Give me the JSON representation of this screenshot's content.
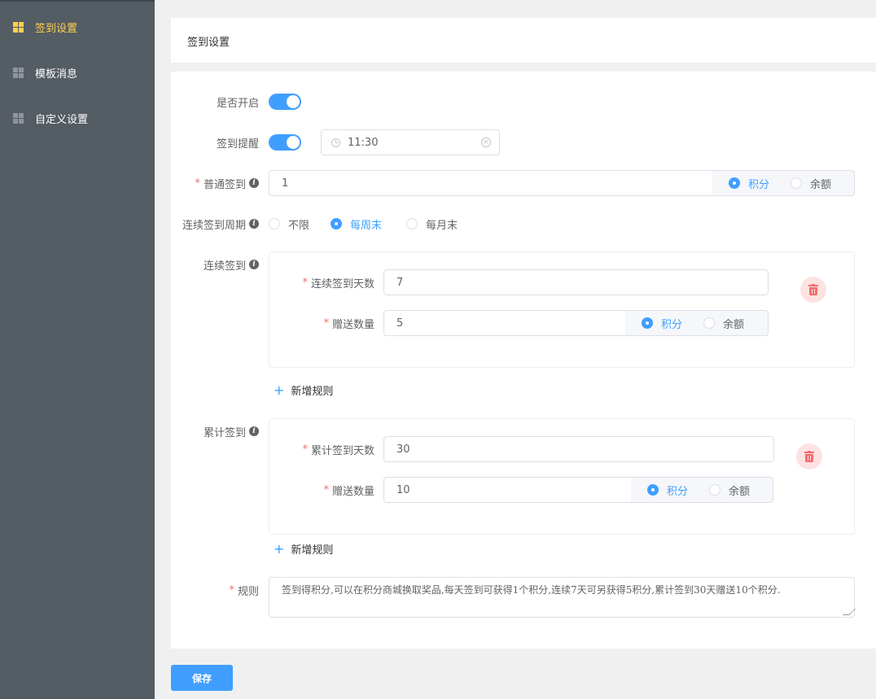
{
  "sidebar": {
    "items": [
      {
        "label": "签到设置",
        "icon": "grid-icon",
        "active": true
      },
      {
        "label": "模板消息",
        "icon": "grid-icon",
        "active": false
      },
      {
        "label": "自定义设置",
        "icon": "grid-icon",
        "active": false
      }
    ]
  },
  "header": {
    "title": "签到设置"
  },
  "form": {
    "enabled_label": "是否开启",
    "enabled": true,
    "reminder_label": "签到提醒",
    "reminder": true,
    "reminder_time": "11:30",
    "normal_label": "普通签到",
    "normal_value": "1",
    "reward_types": [
      "积分",
      "余额"
    ],
    "normal_reward_type": "积分",
    "cycle_label": "连续签到周期",
    "cycle_options": [
      "不限",
      "每周末",
      "每月末"
    ],
    "cycle_selected": "每周末",
    "consecutive_label": "连续签到",
    "consecutive_rules": [
      {
        "days_label": "连续签到天数",
        "days": "7",
        "amount_label": "赠送数量",
        "amount": "5",
        "reward_type": "积分"
      }
    ],
    "cumulative_label": "累计签到",
    "cumulative_rules": [
      {
        "days_label": "累计签到天数",
        "days": "30",
        "amount_label": "赠送数量",
        "amount": "10",
        "reward_type": "积分"
      }
    ],
    "add_rule_label": "新增规则",
    "rules_label": "规则",
    "rules_text": "签到得积分,可以在积分商城换取奖品,每天签到可获得1个积分,连续7天可另获得5积分,累计签到30天赠送10个积分."
  },
  "footer": {
    "save_label": "保存"
  },
  "colors": {
    "primary": "#409eff",
    "sidebar_bg": "#545c64",
    "active": "#ffd04b",
    "danger": "#f56c6c"
  }
}
